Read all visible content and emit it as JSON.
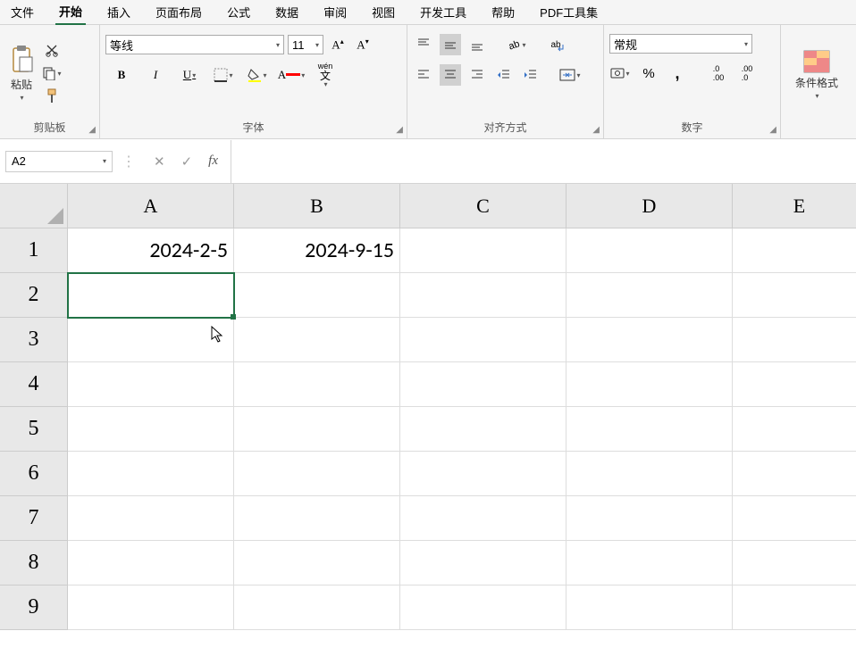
{
  "menu": {
    "items": [
      {
        "label": "文件"
      },
      {
        "label": "开始"
      },
      {
        "label": "插入"
      },
      {
        "label": "页面布局"
      },
      {
        "label": "公式"
      },
      {
        "label": "数据"
      },
      {
        "label": "审阅"
      },
      {
        "label": "视图"
      },
      {
        "label": "开发工具"
      },
      {
        "label": "帮助"
      },
      {
        "label": "PDF工具集"
      }
    ],
    "active_index": 1
  },
  "ribbon": {
    "clipboard": {
      "label": "剪贴板",
      "paste": "粘贴"
    },
    "font": {
      "label": "字体",
      "name": "等线",
      "size": "11",
      "grow_icon": "A",
      "shrink_icon": "A",
      "bold": "B",
      "italic": "I",
      "underline": "U",
      "phonetic": "wén 文"
    },
    "alignment": {
      "label": "对齐方式",
      "wrap_icon": "ab"
    },
    "number": {
      "label": "数字",
      "format": "常规",
      "percent": "%",
      "comma": ","
    },
    "cond_format": {
      "label": "条件格式"
    }
  },
  "formula_bar": {
    "name_box": "A2",
    "cancel": "✕",
    "enter": "✓",
    "fx": "fx",
    "value": ""
  },
  "grid": {
    "columns": [
      "A",
      "B",
      "C",
      "D",
      "E"
    ],
    "rows": [
      "1",
      "2",
      "3",
      "4",
      "5",
      "6",
      "7",
      "8",
      "9"
    ],
    "selected_cell": "A2",
    "data": {
      "A1": "2024-2-5",
      "B1": "2024-9-15"
    }
  }
}
